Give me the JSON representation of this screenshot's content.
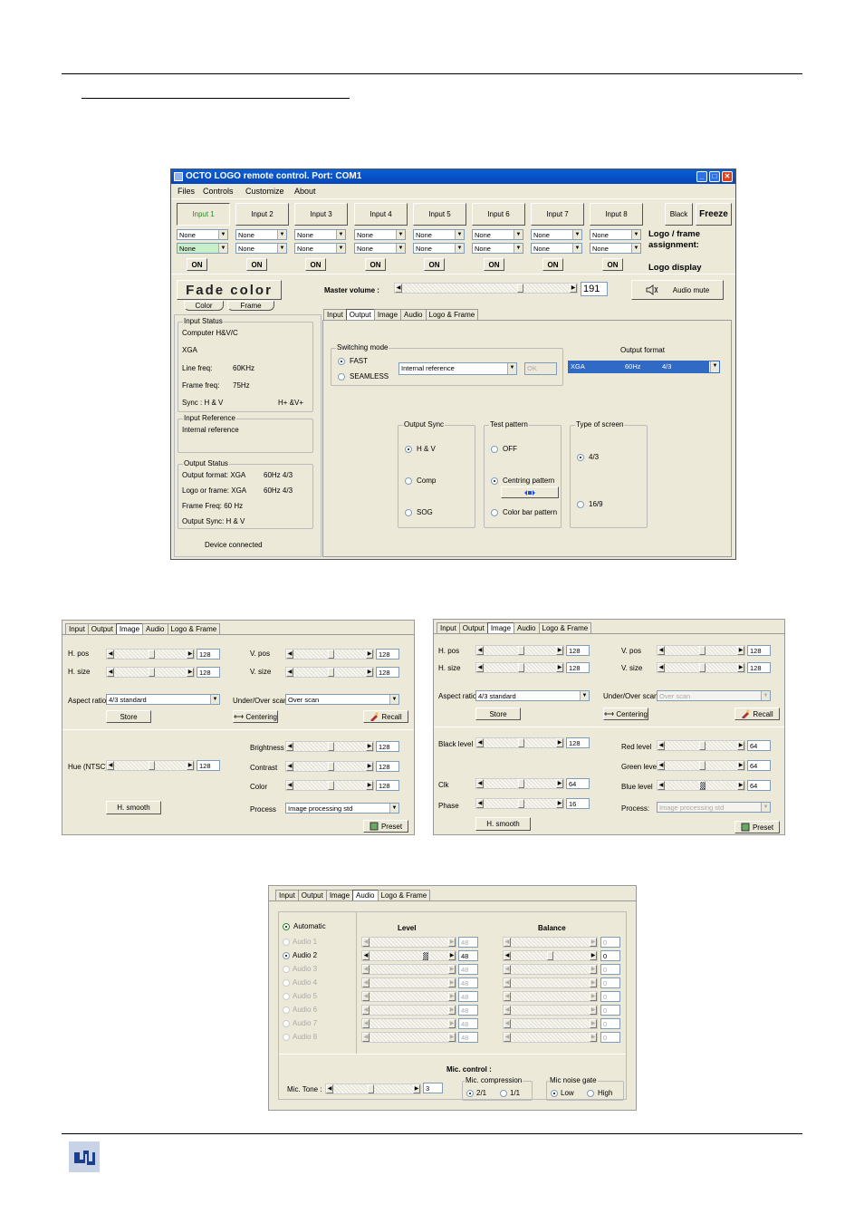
{
  "w1": {
    "title": "OCTO LOGO remote control. Port: COM1",
    "menu": [
      "Files",
      "Controls",
      "Customize",
      "About"
    ],
    "inputs": [
      "Input 1",
      "Input 2",
      "Input 3",
      "Input 4",
      "Input 5",
      "Input 6",
      "Input 7",
      "Input 8"
    ],
    "none": "None",
    "on": "ON",
    "black": "Black",
    "freeze": "Freeze",
    "logo_assign": "Logo / frame assignment:",
    "logo_display": "Logo display",
    "fade": "Fade color",
    "color": "Color",
    "frame": "Frame",
    "mv_label": "Master volume :",
    "mv_value": "191",
    "audio_mute": "Audio mute",
    "tabs": [
      "Input",
      "Output",
      "Image",
      "Audio",
      "Logo & Frame"
    ],
    "input_status": {
      "title": "Input Status",
      "l1": "Computer H&V/C",
      "l2": "XGA",
      "lf": "Line freq:",
      "lf_v": "60KHz",
      "ff": "Frame freq:",
      "ff_v": "75Hz",
      "sync": "Sync : H & V",
      "sync_v": "H+ &V+"
    },
    "input_ref": {
      "title": "Input Reference",
      "l1": "Internal reference"
    },
    "output_status": {
      "title": "Output Status",
      "of": "Output format: XGA",
      "of_v": "60Hz  4/3",
      "lf": "Logo or frame: XGA",
      "lf_v": "60Hz  4/3",
      "ff": "Frame Freq:  60 Hz",
      "os": "Output Sync:   H & V"
    },
    "device": "Device connected",
    "switching": {
      "title": "Switching mode",
      "fast": "FAST",
      "seamless": "SEAMLESS",
      "ref": "Internal reference",
      "ok": "OK"
    },
    "output_format": {
      "title": "Output format",
      "v1": "XGA",
      "v2": "60Hz",
      "v3": "4/3"
    },
    "output_sync": {
      "title": "Output Sync",
      "o1": "H & V",
      "o2": "Comp",
      "o3": "SOG"
    },
    "test": {
      "title": "Test pattern",
      "o1": "OFF",
      "o2": "Centring pattern",
      "o3": "Color bar pattern"
    },
    "screen": {
      "title": "Type of screen",
      "o1": "4/3",
      "o2": "16/9"
    }
  },
  "w2": {
    "tabs": [
      "Input",
      "Output",
      "Image",
      "Audio",
      "Logo & Frame"
    ],
    "hpos": "H. pos",
    "hsize": "H. size",
    "vpos": "V. pos",
    "vsize": "V. size",
    "v128": "128",
    "aspect": "Aspect ratio",
    "aspect_v": "4/3 standard",
    "underover": "Under/Over scan",
    "underover_v": "Over  scan",
    "store": "Store",
    "centering": "Centering",
    "recall": "Recall",
    "hue": "Hue (NTSC)",
    "brightness": "Brightness",
    "contrast": "Contrast",
    "color": "Color",
    "hsmooth": "H. smooth",
    "process": "Process",
    "process_v": "Image processing std",
    "preset": "Preset"
  },
  "w3": {
    "tabs": [
      "Input",
      "Output",
      "Image",
      "Audio",
      "Logo & Frame"
    ],
    "hpos": "H. pos",
    "hsize": "H. size",
    "vpos": "V. pos",
    "vsize": "V. size",
    "v128": "128",
    "aspect": "Aspect ratio",
    "aspect_v": "4/3 standard",
    "underover": "Under/Over scan",
    "underover_v": "Over  scan",
    "store": "Store",
    "centering": "Centering",
    "recall": "Recall",
    "black": "Black level",
    "clk": "Clk",
    "clk_v": "64",
    "phase": "Phase",
    "phase_v": "16",
    "red": "Red level",
    "green": "Green level",
    "blue": "Blue level",
    "v64": "64",
    "hsmooth": "H. smooth",
    "process": "Process:",
    "process_v": "Image processing std",
    "preset": "Preset"
  },
  "w4": {
    "tabs": [
      "Input",
      "Output",
      "Image",
      "Audio",
      "Logo & Frame"
    ],
    "automatic": "Automatic",
    "level": "Level",
    "balance": "Balance",
    "audios": [
      "Audio 1",
      "Audio 2",
      "Audio 3",
      "Audio 4",
      "Audio 5",
      "Audio 6",
      "Audio 7",
      "Audio 8"
    ],
    "lvl": "48",
    "bal": "0",
    "mic_control": "Mic. control :",
    "mic_tone": "Mic. Tone :",
    "mic_tone_v": "3",
    "mic_comp": "Mic. compression",
    "c1": "2/1",
    "c2": "1/1",
    "mic_gate": "Mic noise gate",
    "g1": "Low",
    "g2": "High"
  }
}
